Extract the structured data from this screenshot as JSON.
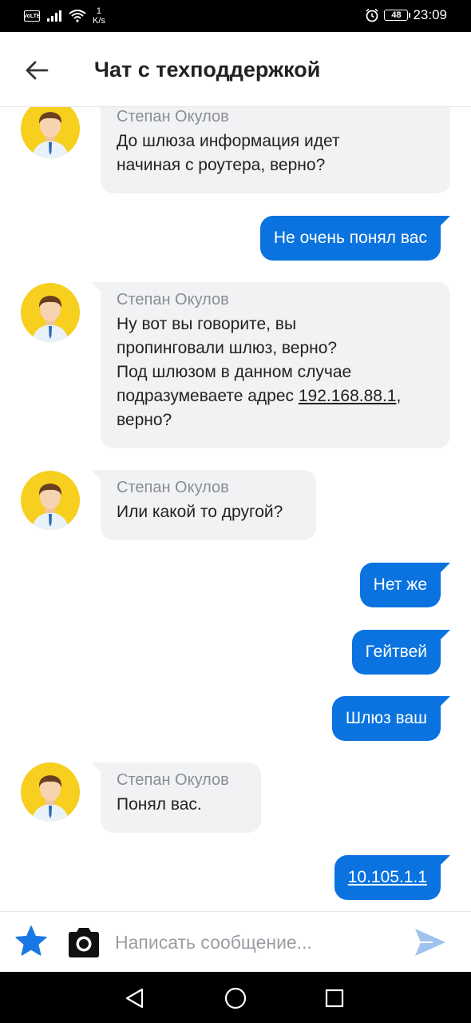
{
  "status_bar": {
    "network_badge": "VoLTE",
    "speed_value": "1",
    "speed_unit": "K/s",
    "battery": "48",
    "time": "23:09",
    "icons": [
      "volte-icon",
      "signal-icon",
      "wifi-icon",
      "alarm-icon",
      "battery-icon"
    ]
  },
  "header": {
    "title": "Чат с техподдержкой",
    "back_icon": "arrow-left-icon"
  },
  "messages": [
    {
      "direction": "incoming",
      "sender": "Степан Окулов",
      "lines": [
        "До шлюза информация идет",
        "начиная с роутера, верно?"
      ]
    },
    {
      "direction": "outgoing",
      "text": "Не очень понял вас"
    },
    {
      "direction": "incoming",
      "sender": "Степан Окулов",
      "lines": [
        "Ну вот вы говорите, вы",
        "пропинговали шлюз, верно?",
        "Под шлюзом в данном случае",
        "подразумеваете адрес "
      ],
      "link": "192.168.88.1",
      "after_link": ",",
      "last_line": "верно?"
    },
    {
      "direction": "incoming",
      "sender": "Степан Окулов",
      "lines": [
        "Или какой то другой?"
      ]
    },
    {
      "direction": "outgoing",
      "text": "Нет же"
    },
    {
      "direction": "outgoing",
      "text": "Гейтвей"
    },
    {
      "direction": "outgoing",
      "text": "Шлюз ваш"
    },
    {
      "direction": "incoming",
      "sender": "Степан Окулов",
      "lines": [
        "Понял вас."
      ]
    },
    {
      "direction": "outgoing",
      "text": "10.105.1.1",
      "is_link": true
    }
  ],
  "input_bar": {
    "placeholder": "Написать сообщение...",
    "icons": [
      "star-icon",
      "camera-icon",
      "send-icon"
    ]
  },
  "nav_bar": {
    "icons": [
      "nav-back-icon",
      "nav-home-icon",
      "nav-recent-icon"
    ]
  },
  "colors": {
    "outgoing_bubble": "#0a73e0",
    "incoming_bubble": "#f1f2f4",
    "avatar_bg": "#f7cf1e",
    "star": "#1a78e6",
    "send": "#9fc3ee"
  }
}
